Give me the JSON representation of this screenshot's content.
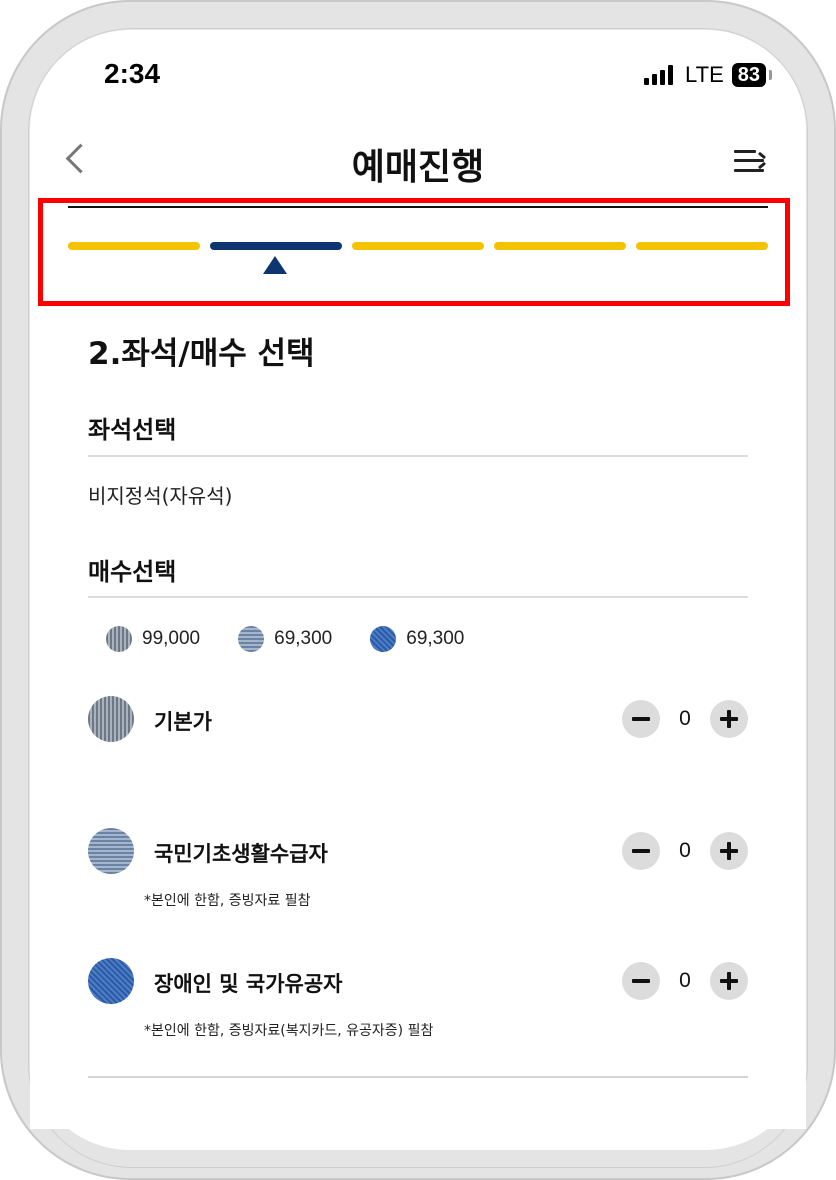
{
  "status": {
    "time": "2:34",
    "network": "LTE",
    "battery": "83"
  },
  "header": {
    "title": "예매진행"
  },
  "progress": {
    "total_steps": 5,
    "current_step": 2
  },
  "section": {
    "title": "2.좌석/매수 선택"
  },
  "seat": {
    "heading": "좌석선택",
    "value": "비지정석(자유석)"
  },
  "count": {
    "heading": "매수선택",
    "legend": [
      {
        "price": "99,000"
      },
      {
        "price": "69,300"
      },
      {
        "price": "69,300"
      }
    ],
    "rows": [
      {
        "label": "기본가",
        "qty": "0",
        "note": ""
      },
      {
        "label": "국민기초생활수급자",
        "qty": "0",
        "note": "*본인에 한함, 증빙자료 필참"
      },
      {
        "label": "장애인 및 국가유공자",
        "qty": "0",
        "note": "*본인에 한함, 증빙자료(복지카드, 유공자증) 필참"
      }
    ]
  },
  "colors": {
    "accent_yellow": "#f4c300",
    "active_navy": "#0d3670",
    "highlight_red": "#ff0000"
  }
}
